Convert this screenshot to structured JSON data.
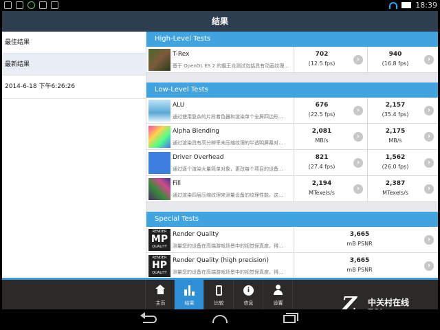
{
  "statusbar": {
    "time": "18:39"
  },
  "titlebar": {
    "title": "结果"
  },
  "sidebar": {
    "items": [
      {
        "label": "最佳结果"
      },
      {
        "label": "最新结果"
      },
      {
        "label": "2014-6-18 下午6:26:26"
      }
    ]
  },
  "sections": {
    "high": {
      "title": "High-Level Tests",
      "rows": [
        {
          "name": "T-Rex",
          "desc": "基于 OpenGL ES 2 的霸王龙测试包括具有动画纹理...",
          "r1a": "702",
          "r1b": "(12.5 fps)",
          "r2a": "940",
          "r2b": "(16.8 fps)"
        }
      ]
    },
    "low": {
      "title": "Low-Level Tests",
      "rows": [
        {
          "name": "ALU",
          "desc": "通过使用复杂的片段着色器和渲染单个全屏四边形...",
          "r1a": "676",
          "r1b": "(22.5 fps)",
          "r2a": "2,157",
          "r2b": "(35.4 fps)"
        },
        {
          "name": "Alpha Blending",
          "desc": "通过渲染具有高分辨率未压缩纹理的半透明屏幕对...",
          "r1a": "2,081",
          "r1b": "MB/s",
          "r2a": "2,175",
          "r2b": "MB/s"
        },
        {
          "name": "Driver Overhead",
          "desc": "通过逐个渲染大量简单对象，更改每个项目的设备...",
          "r1a": "821",
          "r1b": "(27.4 fps)",
          "r2a": "1,562",
          "r2b": "(26.0 fps)"
        },
        {
          "name": "Fill",
          "desc": "通过渲染四层压缩纹理来测量设备的纹理性能。这...",
          "r1a": "2,194",
          "r1b": "MTexels/s",
          "r2a": "2,387",
          "r2b": "MTexels/s"
        }
      ]
    },
    "special": {
      "title": "Special Tests",
      "rows": [
        {
          "name": "Render Quality",
          "desc": "测量您的设备在高端游戏场景中的视觉保真度。得...",
          "logo_top": "RENDER",
          "logo_big": "MP",
          "logo_bottom": "QUALITY",
          "ra": "3,665",
          "rb": "mB PSNR"
        },
        {
          "name": "Render Quality (high precision)",
          "desc": "测量您的设备在高端游戏场景中的视觉保真度。得...",
          "logo_top": "RENDER",
          "logo_big": "HP",
          "logo_bottom": "QUALITY",
          "ra": "3,665",
          "rb": "mB PSNR"
        }
      ]
    }
  },
  "chevron": "›",
  "bottomnav": {
    "items": [
      {
        "label": "主页",
        "icon": "home-icon"
      },
      {
        "label": "结果",
        "icon": "bar-chart-icon",
        "active": true
      },
      {
        "label": "比较",
        "icon": "phone-icon"
      },
      {
        "label": "信息",
        "icon": "info-icon"
      },
      {
        "label": "设置",
        "icon": "user-icon"
      }
    ],
    "info_glyph": "i"
  },
  "watermark": {
    "z": "Z",
    "line1": "中关村在线",
    "line2": "ZOL.com.cn"
  },
  "colors": {
    "accent": "#41a3e0",
    "titlebar": "#2d3f4f",
    "nav_active": "#2f8fd6",
    "nav_bg": "#2c2a27"
  }
}
